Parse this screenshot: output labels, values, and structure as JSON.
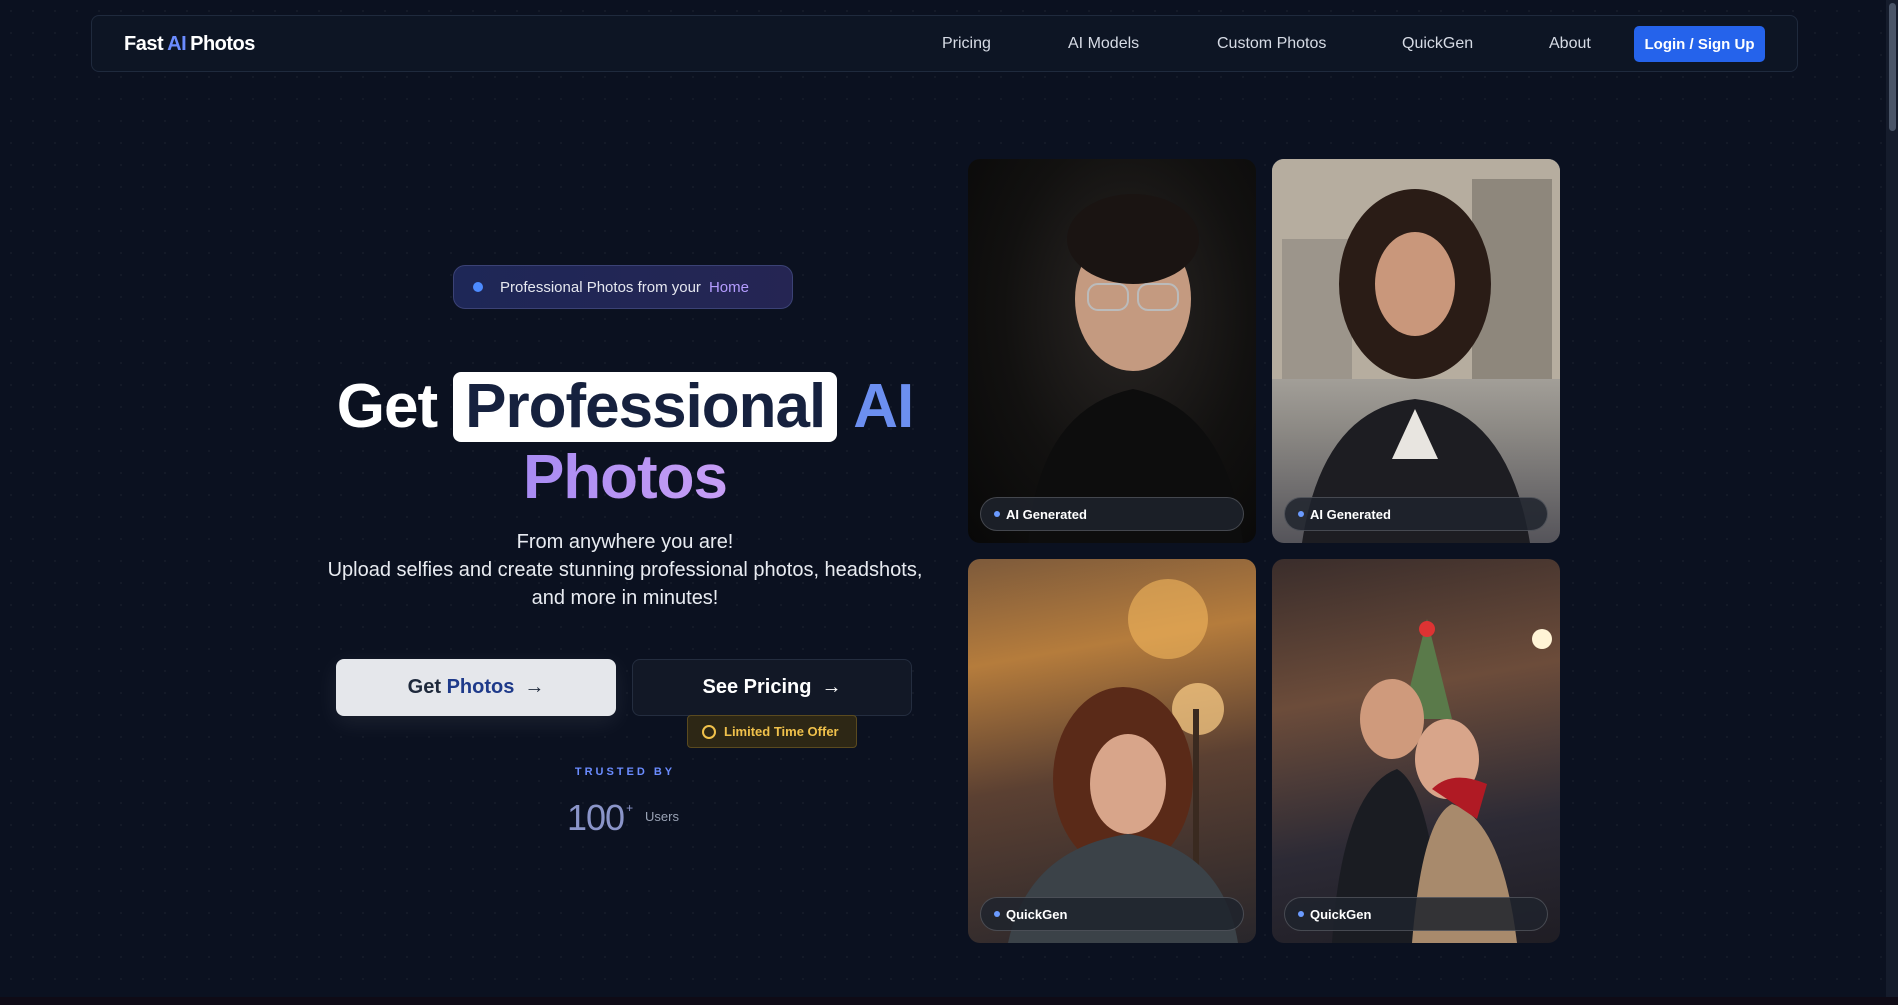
{
  "nav": {
    "logo_fast": "Fast",
    "logo_ai": "AI",
    "logo_photos": "Photos",
    "links": [
      "Pricing",
      "AI Models",
      "Custom Photos",
      "QuickGen",
      "About"
    ],
    "cta": "Login / Sign Up"
  },
  "hero": {
    "badge_text": "Professional Photos from your",
    "badge_highlight": "Home",
    "headline_get": "Get",
    "headline_professional": "Professional",
    "headline_ai": "AI",
    "headline_photos": "Photos",
    "sub_line1": "From anywhere you are!",
    "sub_line2": "Upload selfies and create stunning professional photos, headshots,",
    "sub_line3": "and more in minutes!",
    "primary_btn_a": "Get",
    "primary_btn_b": "Photos",
    "secondary_btn": "See Pricing",
    "offer": "Limited Time Offer",
    "trusted_by": "TRUSTED BY",
    "count": "100",
    "count_suffix": "+",
    "users": "Users"
  },
  "gallery": {
    "cards": [
      {
        "label": "AI Generated"
      },
      {
        "label": "AI Generated"
      },
      {
        "label": "QuickGen"
      },
      {
        "label": "QuickGen"
      }
    ]
  },
  "colors": {
    "background": "#0b1120",
    "accent_blue": "#2563eb",
    "headline_ai": "#6c8ff0",
    "headline_photos": "#b394f4",
    "offer_gold": "#f0c14b"
  }
}
